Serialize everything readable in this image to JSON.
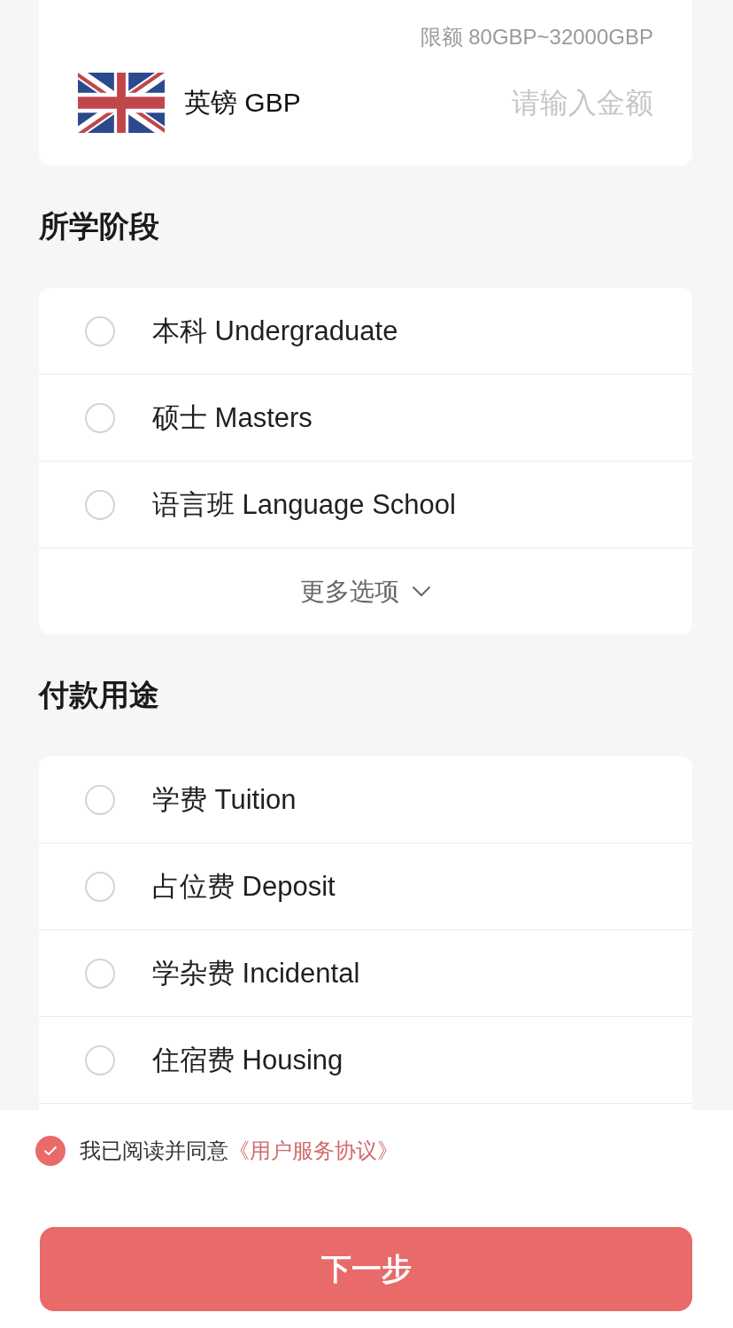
{
  "amount_card": {
    "limit": "限额 80GBP~32000GBP",
    "currency": "英镑 GBP",
    "amount": {
      "placeholder": "请输入金额"
    }
  },
  "sections": [
    {
      "title": "所学阶段",
      "options": [
        {
          "label": "本科 Undergraduate",
          "selected": false
        },
        {
          "label": "硕士 Masters",
          "selected": false
        },
        {
          "label": "语言班 Language School",
          "selected": false
        }
      ],
      "more": "更多选项"
    },
    {
      "title": "付款用途",
      "options": [
        {
          "label": "学费 Tuition",
          "selected": false
        },
        {
          "label": "占位费 Deposit",
          "selected": false
        },
        {
          "label": "学杂费 Incidental",
          "selected": false
        },
        {
          "label": "住宿费 Housing",
          "selected": false
        }
      ]
    }
  ],
  "agreement": {
    "checked": true,
    "text": "我已阅读并同意",
    "link": "《用户服务协议》"
  },
  "next_button": "下一步"
}
